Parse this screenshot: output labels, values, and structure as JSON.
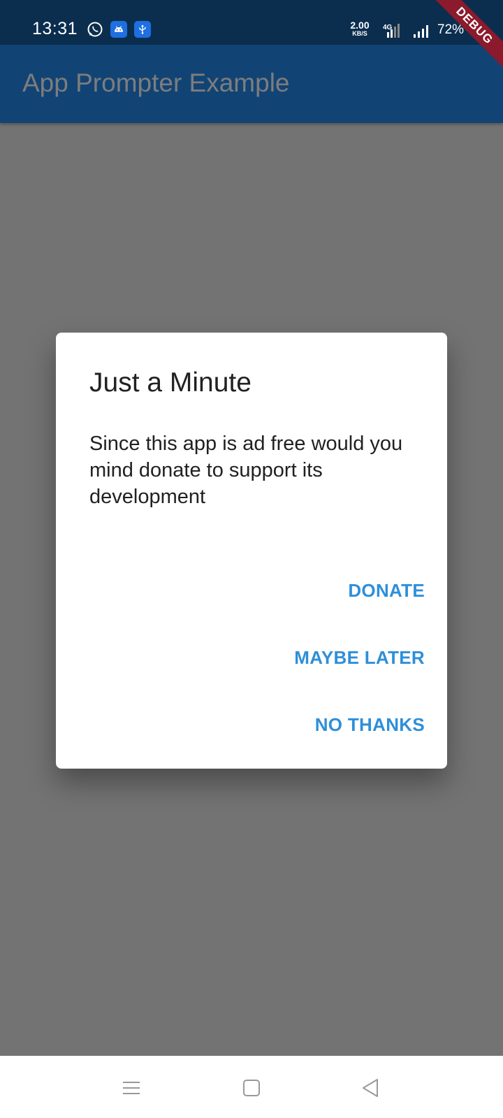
{
  "status_bar": {
    "time": "13:31",
    "net_speed_value": "2.00",
    "net_speed_unit": "KB/S",
    "network_type": "4G",
    "battery": "72%",
    "icons": [
      "whatsapp-icon",
      "android-icon",
      "usb-icon",
      "signal-4g-icon",
      "signal-icon",
      "battery-icon"
    ]
  },
  "debug_banner": "DEBUG",
  "app_bar": {
    "title": "App Prompter Example"
  },
  "dialog": {
    "title": "Just a Minute",
    "message": "Since this app is ad free would you mind donate to support its development",
    "buttons": {
      "donate": "DONATE",
      "maybe_later": "MAYBE LATER",
      "no_thanks": "NO THANKS"
    }
  },
  "nav_bar": {
    "icons": [
      "menu-icon",
      "home-square-icon",
      "back-triangle-icon"
    ]
  },
  "colors": {
    "status_bar": "#0b2e4f",
    "app_bar": "#114475",
    "scrim": "#737373",
    "accent": "#2e8fd9",
    "debug_ribbon": "#8b1a2c"
  }
}
